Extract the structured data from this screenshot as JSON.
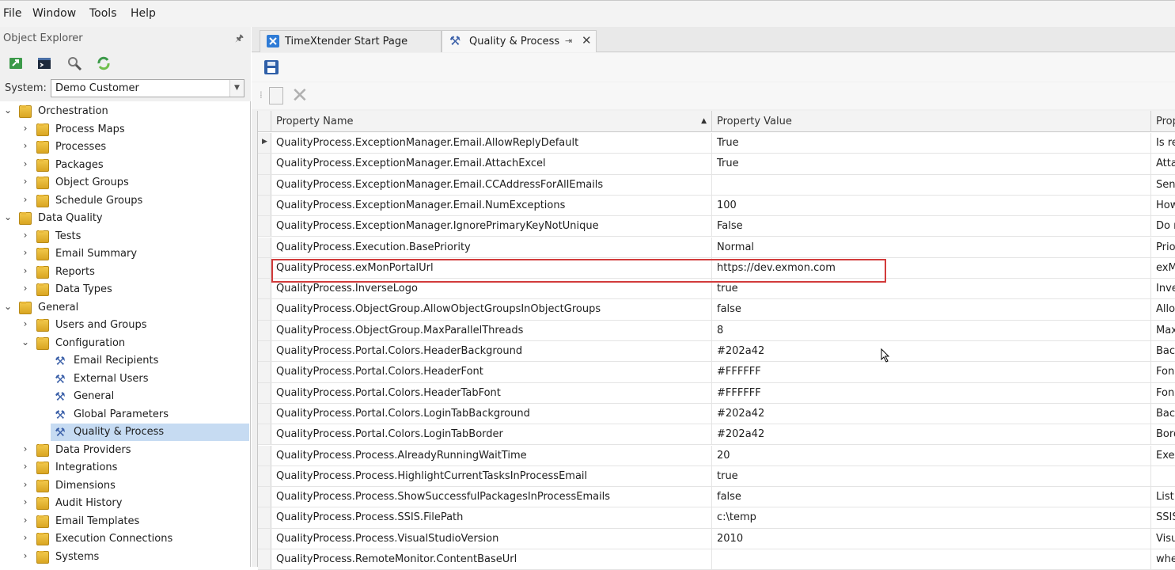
{
  "menu": [
    "File",
    "Window",
    "Tools",
    "Help"
  ],
  "explorer": {
    "title": "Object Explorer",
    "pin": "🖈",
    "system_label": "System:",
    "system_value": "Demo Customer",
    "tree": [
      {
        "label": "Orchestration",
        "level": 0,
        "expanded": true
      },
      {
        "label": "Process Maps",
        "level": 1
      },
      {
        "label": "Processes",
        "level": 1
      },
      {
        "label": "Packages",
        "level": 1
      },
      {
        "label": "Object Groups",
        "level": 1
      },
      {
        "label": "Schedule Groups",
        "level": 1
      },
      {
        "label": "Data Quality",
        "level": 0,
        "expanded": true
      },
      {
        "label": "Tests",
        "level": 1
      },
      {
        "label": "Email Summary",
        "level": 1
      },
      {
        "label": "Reports",
        "level": 1
      },
      {
        "label": "Data Types",
        "level": 1
      },
      {
        "label": "General",
        "level": 0,
        "expanded": true
      },
      {
        "label": "Users and Groups",
        "level": 1
      },
      {
        "label": "Configuration",
        "level": 1,
        "expanded": true
      },
      {
        "label": "Email Recipients",
        "level": 2,
        "icon": "wrench"
      },
      {
        "label": "External Users",
        "level": 2,
        "icon": "wrench"
      },
      {
        "label": "General",
        "level": 2,
        "icon": "wrench"
      },
      {
        "label": "Global Parameters",
        "level": 2,
        "icon": "wrench"
      },
      {
        "label": "Quality & Process",
        "level": 2,
        "icon": "wrench",
        "selected": true
      },
      {
        "label": "Data Providers",
        "level": 1
      },
      {
        "label": "Integrations",
        "level": 1
      },
      {
        "label": "Dimensions",
        "level": 1
      },
      {
        "label": "Audit History",
        "level": 1
      },
      {
        "label": "Email Templates",
        "level": 1
      },
      {
        "label": "Execution Connections",
        "level": 1
      },
      {
        "label": "Systems",
        "level": 1
      }
    ]
  },
  "tabs": [
    {
      "label": "TimeXtender Start Page",
      "active": false
    },
    {
      "label": "Quality & Process",
      "active": true,
      "pin": "⇥",
      "close": "✕"
    }
  ],
  "grid": {
    "columns": [
      "Property Name",
      "Property Value",
      "Prop"
    ],
    "rows": [
      [
        "QualityProcess.ExceptionManager.Email.AllowReplyDefault",
        "True",
        "Is re"
      ],
      [
        "QualityProcess.ExceptionManager.Email.AttachExcel",
        "True",
        "Atta"
      ],
      [
        "QualityProcess.ExceptionManager.Email.CCAddressForAllEmails",
        "",
        "Sen"
      ],
      [
        "QualityProcess.ExceptionManager.Email.NumExceptions",
        "100",
        "How"
      ],
      [
        "QualityProcess.ExceptionManager.IgnorePrimaryKeyNotUnique",
        "False",
        "Do n"
      ],
      [
        "QualityProcess.Execution.BasePriority",
        "Normal",
        "Prio"
      ],
      [
        "QualityProcess.exMonPortalUrl",
        "https://dev.exmon.com",
        "exM"
      ],
      [
        "QualityProcess.InverseLogo",
        "true",
        "Inve"
      ],
      [
        "QualityProcess.ObjectGroup.AllowObjectGroupsInObjectGroups",
        "false",
        "Allo"
      ],
      [
        "QualityProcess.ObjectGroup.MaxParallelThreads",
        "8",
        "Max"
      ],
      [
        "QualityProcess.Portal.Colors.HeaderBackground",
        "#202a42",
        "Back"
      ],
      [
        "QualityProcess.Portal.Colors.HeaderFont",
        "#FFFFFF",
        "Fon"
      ],
      [
        "QualityProcess.Portal.Colors.HeaderTabFont",
        "#FFFFFF",
        "Fon"
      ],
      [
        "QualityProcess.Portal.Colors.LoginTabBackground",
        "#202a42",
        "Back"
      ],
      [
        "QualityProcess.Portal.Colors.LoginTabBorder",
        "#202a42",
        "Bord"
      ],
      [
        "QualityProcess.Process.AlreadyRunningWaitTime",
        "20",
        "Exe"
      ],
      [
        "QualityProcess.Process.HighlightCurrentTasksInProcessEmail",
        "true",
        ""
      ],
      [
        "QualityProcess.Process.ShowSuccessfulPackagesInProcessEmails",
        "false",
        "List"
      ],
      [
        "QualityProcess.Process.SSIS.FilePath",
        "c:\\temp",
        "SSIS"
      ],
      [
        "QualityProcess.Process.VisualStudioVersion",
        "2010",
        "Visu"
      ],
      [
        "QualityProcess.RemoteMonitor.ContentBaseUrl",
        "",
        "whe"
      ]
    ]
  },
  "colors": {
    "highlight": "#d23b3b",
    "selection": "#c6dbf2",
    "folder": "#e8b83a"
  }
}
